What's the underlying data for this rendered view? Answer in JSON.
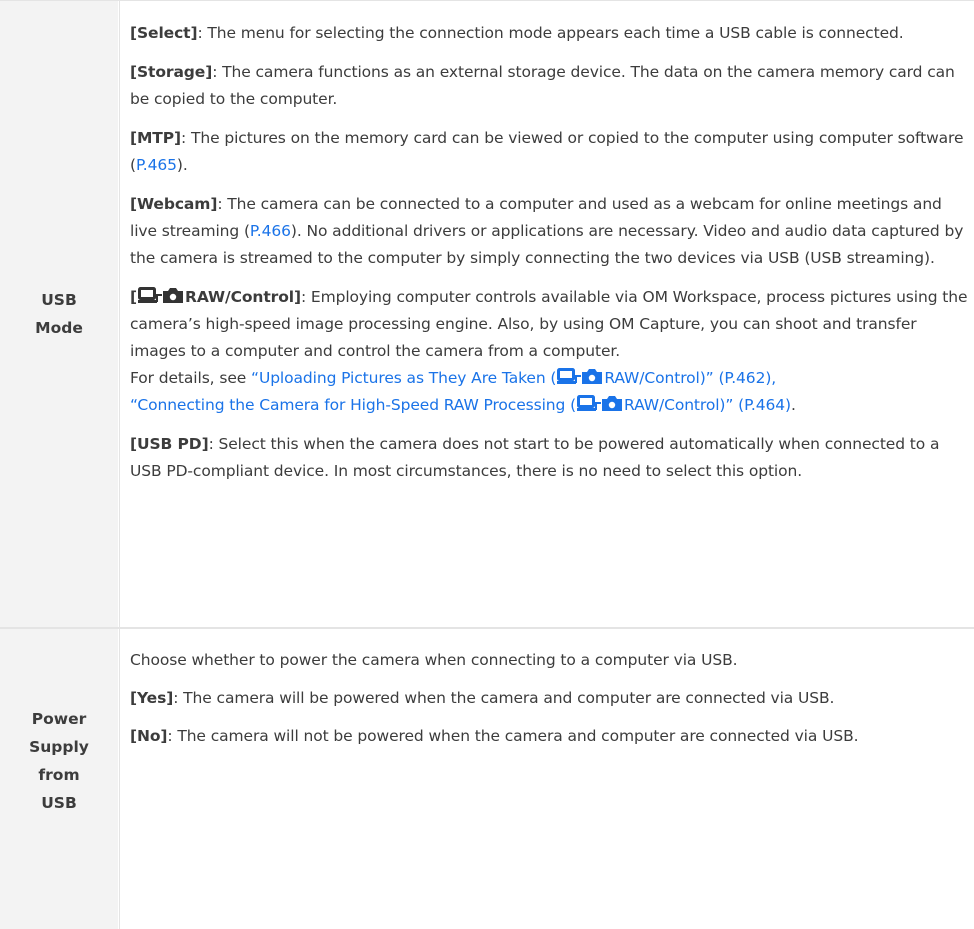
{
  "rows": [
    {
      "header": "USB Mode",
      "items": [
        {
          "key": "[Select]",
          "text": ": The menu for selecting the connection mode appears each time a USB cable is connected."
        },
        {
          "key": "[Storage]",
          "text": ": The camera functions as an external storage device. The data on the camera memory card can be copied to the computer."
        },
        {
          "key": "[MTP]",
          "text_before": ": The pictures on the memory card can be viewed or copied to the computer using computer software (",
          "link": "P.465",
          "text_after": ")."
        },
        {
          "key": "[Webcam]",
          "text_before": ": The camera can be connected to a computer and used as a webcam for online meetings and live streaming (",
          "link": "P.466",
          "text_after": "). No additional drivers or applications are necessary. Video and audio data captured by the camera is streamed to the computer by simply connecting the two devices via USB (USB streaming)."
        },
        {
          "key_open": "[",
          "key_main": "RAW/Control]",
          "text": ": Employing computer controls available via OM Workspace, process pictures using the camera’s high-speed image processing engine. Also, by using OM Capture, you can shoot and transfer images to a computer and control the camera from a computer.",
          "details_prefix": "For details, see ",
          "link1_a": "“Uploading Pictures as They Are Taken (",
          "link1_b": "RAW/Control)” (P.462)",
          "sep": ",",
          "link2_a": "“Connecting the Camera for High-Speed RAW Processing (",
          "link2_b": "RAW/Control)” (P.464)",
          "end": "."
        },
        {
          "key": "[USB PD]",
          "text": ": Select this when the camera does not start to be powered automatically when connected to a USB PD-compliant device. In most circumstances, there is no need to select this option."
        }
      ]
    },
    {
      "header": "Power Supply from USB",
      "intro": "Choose whether to power the camera when connecting to a computer via USB.",
      "items": [
        {
          "key": "[Yes]",
          "text": ": The camera will be powered when the camera and computer are connected via USB."
        },
        {
          "key": "[No]",
          "text": ": The camera will not be powered when the camera and computer are connected via USB."
        }
      ]
    }
  ],
  "colors": {
    "link": "#1a73e8",
    "header_bg": "#f3f3f3",
    "border": "#e4e4e4",
    "text": "#3c3c3c"
  },
  "icons": [
    "pc-camera-connection-icon"
  ]
}
